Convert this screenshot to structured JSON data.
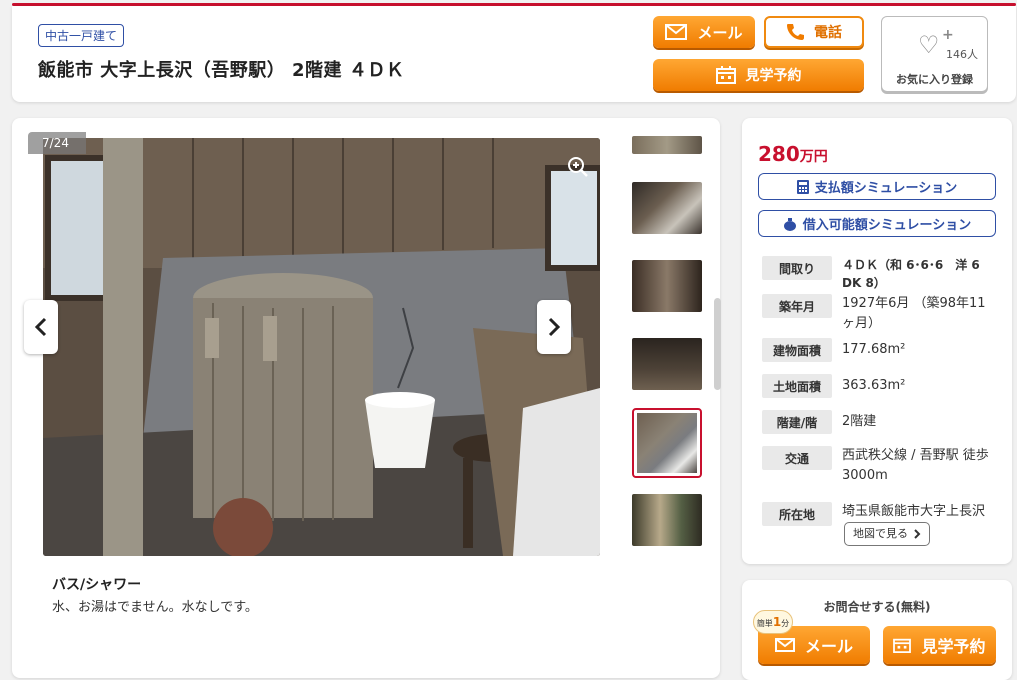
{
  "header": {
    "badge": "中古一戸建て",
    "title": "飯能市 大字上長沢（吾野駅） 2階建 ４ＤＫ",
    "mail_label": "メール",
    "tel_label": "電話",
    "visit_label": "見学予約",
    "favorite_count": "146人",
    "favorite_label": "お気に入り登録"
  },
  "gallery": {
    "counter": "7/24",
    "caption_title": "バス/シャワー",
    "caption_text": "水、お湯はでません。水なしです。",
    "thumb_count": 6,
    "active_thumb_index": 4
  },
  "side": {
    "price_value": "280",
    "price_unit": "万円",
    "sim_payment": "支払額シミュレーション",
    "sim_borrow": "借入可能額シミュレーション",
    "specs": [
      {
        "key": "間取り",
        "value": "４ＤＫ（和 6･6･6　洋 6 DK 8）"
      },
      {
        "key": "築年月",
        "value": "1927年6月 （築98年11ヶ月）"
      },
      {
        "key": "建物面積",
        "value": "177.68m²"
      },
      {
        "key": "土地面積",
        "value": "363.63m²"
      },
      {
        "key": "階建/階",
        "value": "2階建"
      },
      {
        "key": "交通",
        "value": "西武秩父線 / 吾野駅 徒歩3000m"
      },
      {
        "key": "所在地",
        "value": "埼玉県飯能市大字上長沢"
      }
    ],
    "map_button": "地図で見る"
  },
  "contact": {
    "title": "お問合せする(無料)",
    "easy_prefix": "簡単",
    "easy_num": "1",
    "easy_suffix": "分",
    "mail_label": "メール",
    "visit_label": "見学予約"
  },
  "colors": {
    "accent_red": "#c8102e",
    "accent_orange": "#f07c00",
    "link_blue": "#2f4fa5"
  }
}
